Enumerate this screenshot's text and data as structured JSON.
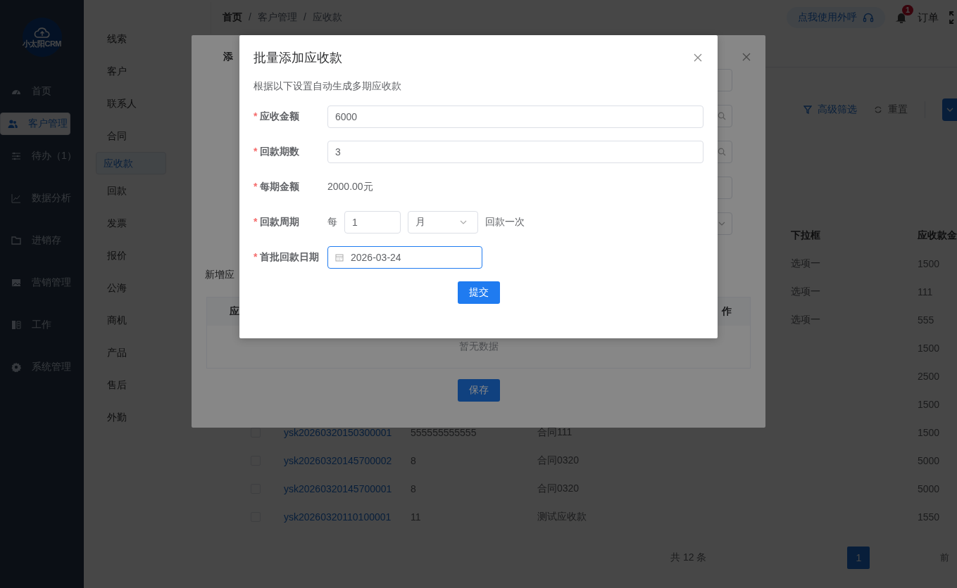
{
  "nav": {
    "logo": "小太阳CRM",
    "items": [
      {
        "label": "首页",
        "selected": false
      },
      {
        "label": "客户管理",
        "selected": true
      },
      {
        "label": "待办（1）",
        "selected": false
      },
      {
        "label": "数据分析",
        "selected": false
      },
      {
        "label": "进销存",
        "selected": false
      },
      {
        "label": "营销管理",
        "selected": false
      },
      {
        "label": "工作",
        "selected": false
      },
      {
        "label": "系统管理",
        "selected": false
      }
    ]
  },
  "subnav": {
    "items": [
      {
        "label": "线索",
        "selected": false
      },
      {
        "label": "客户",
        "selected": false
      },
      {
        "label": "联系人",
        "selected": false
      },
      {
        "label": "合同",
        "selected": false
      },
      {
        "label": "应收款",
        "selected": true
      },
      {
        "label": "回款",
        "selected": false
      },
      {
        "label": "发票",
        "selected": false
      },
      {
        "label": "报价",
        "selected": false
      },
      {
        "label": "公海",
        "selected": false
      },
      {
        "label": "商机",
        "selected": false
      },
      {
        "label": "产品",
        "selected": false
      },
      {
        "label": "售后",
        "selected": false
      },
      {
        "label": "外勤",
        "selected": false
      }
    ]
  },
  "header": {
    "breadcrumb": [
      "首页",
      "客户管理",
      "应收款"
    ],
    "separator": "/",
    "call_button": "点我使用外呼",
    "notification_count": "1",
    "orders": "订单"
  },
  "toolbar": {
    "advanced_filter": "高级筛选",
    "reset": "重置"
  },
  "table": {
    "headers": [
      "下拉框",
      "应收款金"
    ],
    "rows": [
      {
        "dropdown": "选项一",
        "amount": "1500"
      },
      {
        "dropdown": "选项一",
        "amount": "111"
      },
      {
        "dropdown": "选项一",
        "amount": "555"
      },
      {
        "amount": "1500"
      },
      {
        "amount": "2500"
      },
      {
        "amount": "1500"
      },
      {
        "checked": false,
        "id": "ysk20260320150300001",
        "column_2": "555555555555",
        "column_3": "合同111",
        "amount": "1500"
      },
      {
        "checked": false,
        "id": "ysk20260320145700002",
        "column_2": "8",
        "column_3": "合同0320",
        "amount": "5000"
      },
      {
        "checked": false,
        "id": "ysk20260320145700001",
        "column_2": "8",
        "column_3": "合同0320",
        "amount": "5000"
      },
      {
        "checked": false,
        "id": "ysk20260320110100001",
        "column_2": "11",
        "column_3": "测试应收款",
        "amount": "1550"
      }
    ]
  },
  "pagination": {
    "total": "共 12 条",
    "pages": [
      {
        "label": "1",
        "selected": true
      }
    ],
    "goto": "前"
  },
  "add_dialog": {
    "title": "添",
    "fields": [
      {
        "kind": "input"
      },
      {
        "kind": "search"
      },
      {
        "kind": "search"
      },
      {
        "kind": "input"
      },
      {
        "kind": "select"
      }
    ],
    "section_title": "新增应",
    "table": {
      "columns": [
        "应",
        "作"
      ],
      "empty_text": "暂无数据"
    },
    "save_button": "保存"
  },
  "batch_dialog": {
    "title": "批量添加应收款",
    "required_mark": "*",
    "subtitle": "根据以下设置自动生成多期应收款",
    "fields": [
      {
        "kind": "input",
        "label": "应收金额",
        "required": true,
        "value": "6000",
        "focused": false
      },
      {
        "kind": "input",
        "label": "回款期数",
        "required": true,
        "value": "3",
        "focused": false
      },
      {
        "kind": "text",
        "label": "每期金额",
        "required": true,
        "value": "2000.00元"
      },
      {
        "kind": "period",
        "label": "回款周期",
        "required": true,
        "prefix": "每",
        "value": "1",
        "unit": "月",
        "suffix": "回款一次"
      },
      {
        "kind": "date",
        "label": "首批回款日期",
        "required": true,
        "value": "2026-03-24",
        "focused": true
      }
    ],
    "submit_button": "提交"
  }
}
